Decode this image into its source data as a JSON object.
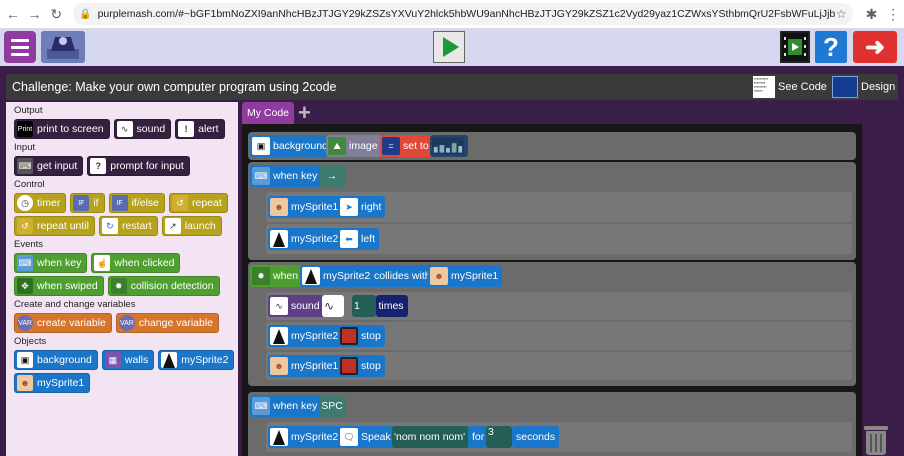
{
  "browser": {
    "url": "purplemash.com/#~bGF1bmNoZXI9anNhcHBzJTJGY29kZSZsYXVuY2hlck5hbWU9anNhcHBzJTJGY29kZSZ1c2Vyd29yaz1CZWxsYSthbmQrU2FsbWFuLjJjb2RlJmZ1bGxQYXRo..."
  },
  "header": {
    "menu_icon": "hamburger-icon",
    "play_icon": "play-icon",
    "help_label": "?",
    "back_icon": "arrow-left-icon"
  },
  "challenge": {
    "title": "Challenge: Make your own computer program using 2code",
    "see_code_label": "See Code",
    "design_label": "Design"
  },
  "palette": {
    "output_heading": "Output",
    "input_heading": "Input",
    "control_heading": "Control",
    "events_heading": "Events",
    "variables_heading": "Create and change variables",
    "objects_heading": "Objects",
    "output": [
      "print to screen",
      "sound",
      "alert"
    ],
    "output_print_icon_text": "Print",
    "input": [
      "get input",
      "prompt for input"
    ],
    "control": [
      "timer",
      "if",
      "if/else",
      "repeat",
      "repeat until",
      "restart",
      "launch"
    ],
    "control_if_icon_text": "IF",
    "events": [
      "when key",
      "when clicked",
      "when swiped",
      "collision detection"
    ],
    "variables": [
      "create variable",
      "change variable"
    ],
    "variables_icon_text": "VAR",
    "objects": [
      "background",
      "walls",
      "mySprite2",
      "mySprite1"
    ]
  },
  "code": {
    "tab_label": "My Code",
    "add_tab": "+",
    "s1": {
      "background": "background",
      "image": "image",
      "set_to": "set to"
    },
    "s2": {
      "when_key": "when key",
      "key": "→"
    },
    "s2a": {
      "sprite": "mySprite1",
      "dir": "right"
    },
    "s2b": {
      "sprite": "mySprite2",
      "dir": "left"
    },
    "s3": {
      "when": "when",
      "sprite_a": "mySprite2",
      "collides_with": "collides with",
      "sprite_b": "mySprite1"
    },
    "s3a": {
      "sound": "sound",
      "count": "1",
      "times": "times"
    },
    "s3b": {
      "sprite": "mySprite2",
      "stop": "stop"
    },
    "s3c": {
      "sprite": "mySprite1",
      "stop": "stop"
    },
    "s4": {
      "when_key": "when key",
      "key": "SPC"
    },
    "s4a": {
      "sprite": "mySprite2",
      "speak": "Speak",
      "text": "'nom nom nom'",
      "for": "for",
      "seconds_value": "3",
      "seconds": "seconds"
    }
  },
  "colors": {
    "purple": "#8e3c9e",
    "blue": "#1976c9",
    "green": "#4f9e30",
    "olive": "#b6a21c",
    "orange": "#d6762d",
    "red": "#e0493a"
  }
}
